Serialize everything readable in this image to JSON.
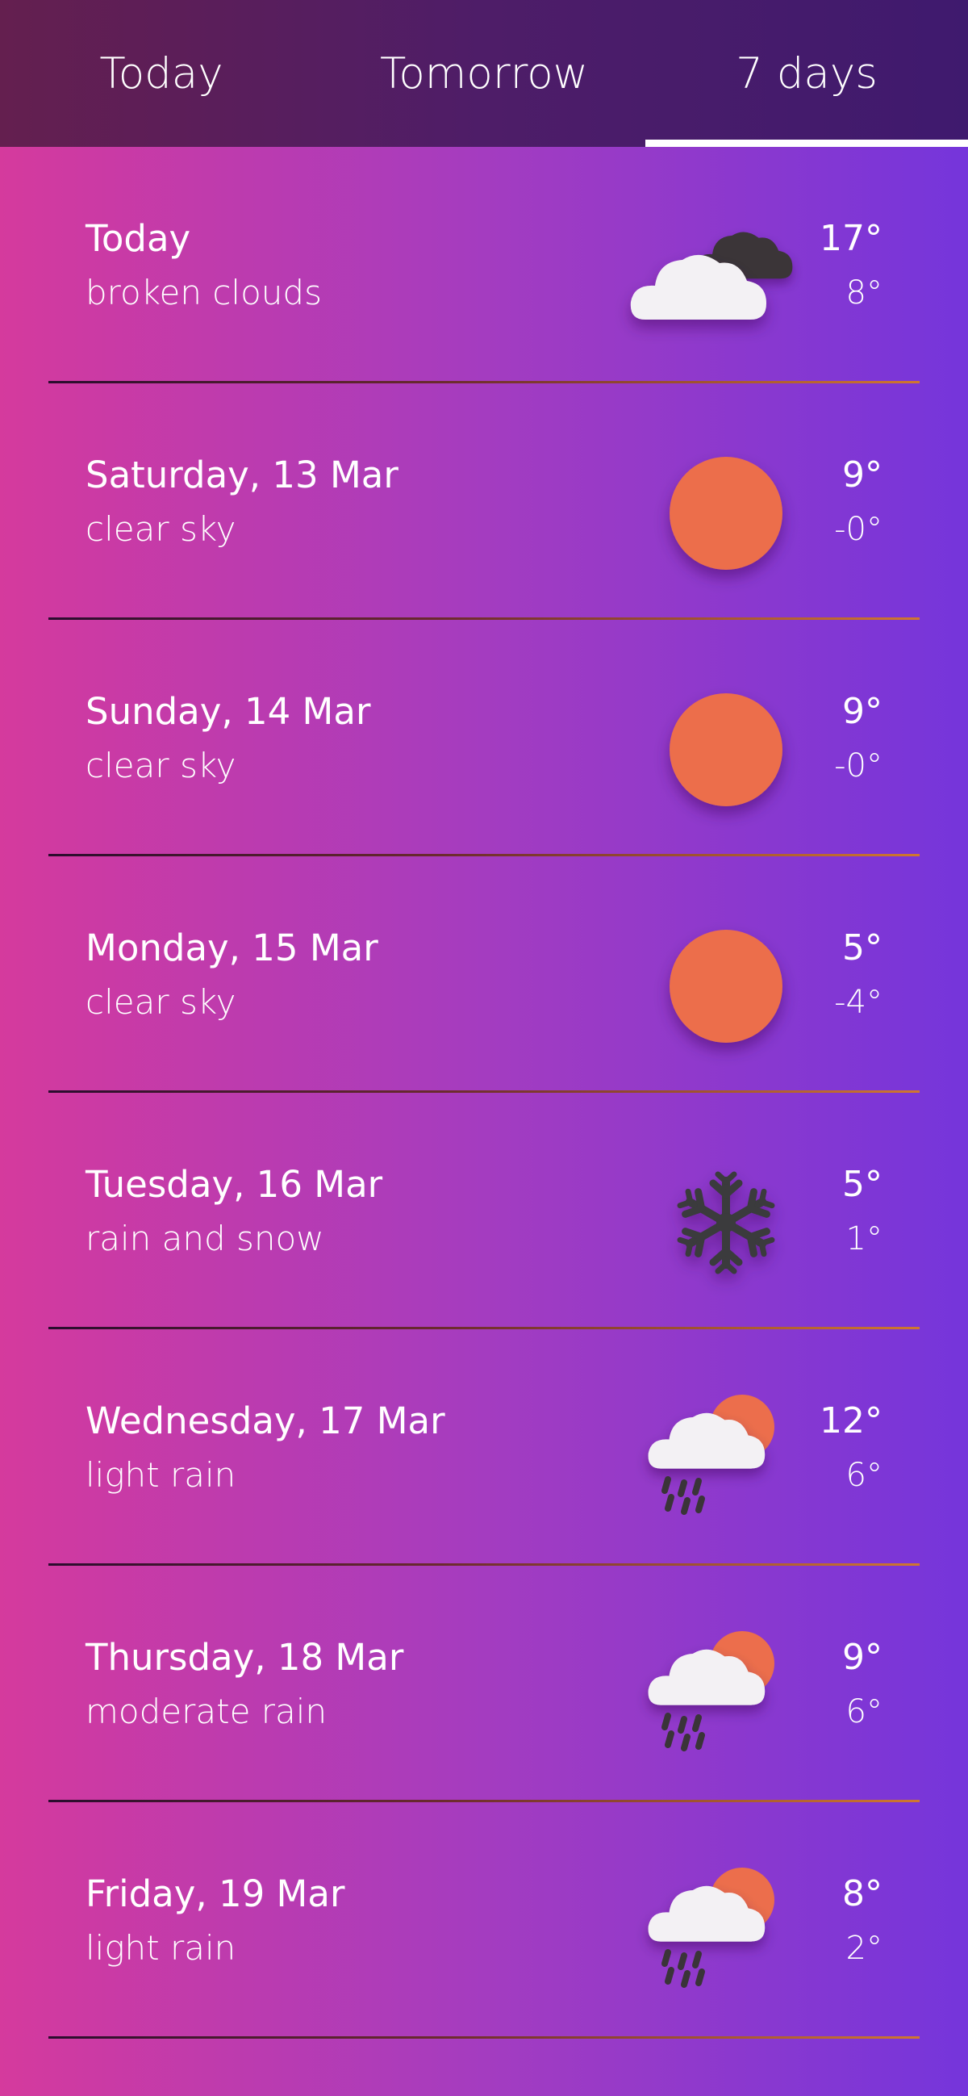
{
  "tabs": [
    {
      "label": "Today",
      "active": false
    },
    {
      "label": "Tomorrow",
      "active": false
    },
    {
      "label": "7 days",
      "active": true
    }
  ],
  "forecast": [
    {
      "day": "Today",
      "desc": "broken clouds",
      "hi": "17°",
      "lo": "8°",
      "icon": "broken-clouds-icon"
    },
    {
      "day": "Saturday, 13 Mar",
      "desc": "clear sky",
      "hi": "9°",
      "lo": "-0°",
      "icon": "sun-icon"
    },
    {
      "day": "Sunday, 14 Mar",
      "desc": "clear sky",
      "hi": "9°",
      "lo": "-0°",
      "icon": "sun-icon"
    },
    {
      "day": "Monday, 15 Mar",
      "desc": "clear sky",
      "hi": "5°",
      "lo": "-4°",
      "icon": "sun-icon"
    },
    {
      "day": "Tuesday, 16 Mar",
      "desc": "rain and snow",
      "hi": "5°",
      "lo": "1°",
      "icon": "snowflake-icon"
    },
    {
      "day": "Wednesday, 17 Mar",
      "desc": "light rain",
      "hi": "12°",
      "lo": "6°",
      "icon": "sun-cloud-rain-icon"
    },
    {
      "day": "Thursday, 18 Mar",
      "desc": "moderate rain",
      "hi": "9°",
      "lo": "6°",
      "icon": "sun-cloud-rain-icon"
    },
    {
      "day": "Friday, 19 Mar",
      "desc": "light rain",
      "hi": "8°",
      "lo": "2°",
      "icon": "sun-cloud-rain-icon"
    }
  ],
  "colors": {
    "sun": "#ec6e4c",
    "cloud": "#f3f1f4",
    "dark_cloud": "#3a3438",
    "snow": "#3a3a3e",
    "divider_end": "#d0772f"
  }
}
